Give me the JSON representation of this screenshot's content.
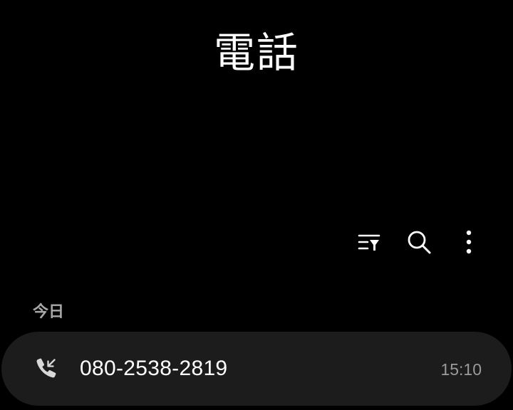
{
  "header": {
    "title": "電話"
  },
  "toolbar": {
    "buttons": [
      {
        "icon": "filter-list-icon"
      },
      {
        "icon": "search-icon"
      },
      {
        "icon": "more-vertical-icon"
      }
    ]
  },
  "call_log": {
    "sections": [
      {
        "header": "今日",
        "items": [
          {
            "type_icon": "incoming-call-icon",
            "number": "080-2538-2819",
            "time": "15:10"
          }
        ]
      }
    ]
  },
  "colors": {
    "background": "#000000",
    "card": "#1c1c1c",
    "primary_text": "#ffffff",
    "secondary_text": "#9a9a9a",
    "section_header": "#a8a8a8"
  }
}
